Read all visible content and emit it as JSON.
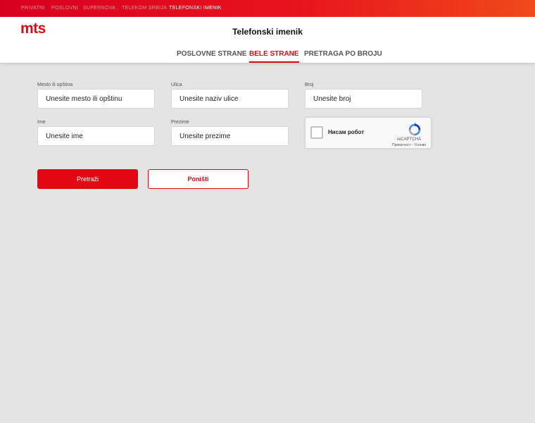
{
  "topnav": {
    "items": [
      {
        "label": "PRIVATNI",
        "active": false
      },
      {
        "label": "POSLOVNI",
        "active": false
      },
      {
        "label": "SUPERNOVA",
        "active": false
      },
      {
        "label": "TELEKOM SRBIJA",
        "active": false
      },
      {
        "label": "TELEFONSKI IMENIK",
        "active": true
      }
    ]
  },
  "header": {
    "logo": "mts",
    "title": "Telefonski imenik",
    "tabs": [
      {
        "label": "POSLOVNE STRANE",
        "active": false
      },
      {
        "label": "BELE STRANE",
        "active": true
      },
      {
        "label": "PRETRAGA PO BROJU",
        "active": false
      }
    ]
  },
  "form": {
    "place": {
      "label": "Mesto ili opština",
      "placeholder": "Unesite mesto ili opštinu",
      "value": ""
    },
    "street": {
      "label": "Ulica",
      "placeholder": "Unesite naziv ulice",
      "value": ""
    },
    "number": {
      "label": "Broj",
      "placeholder": "Unesite broj",
      "value": ""
    },
    "first_name": {
      "label": "Ime",
      "placeholder": "Unesite ime",
      "value": ""
    },
    "last_name": {
      "label": "Prezime",
      "placeholder": "Unesite prezime",
      "value": ""
    },
    "search_label": "Pretraži",
    "reset_label": "Poništi"
  },
  "captcha": {
    "label": "Нисам робот",
    "brand": "reCAPTCHA",
    "links": "Приватност - Услови"
  },
  "colors": {
    "brand": "#e30613",
    "topbar_gradient_end": "#f04a1a",
    "background": "#e4e4e4"
  }
}
